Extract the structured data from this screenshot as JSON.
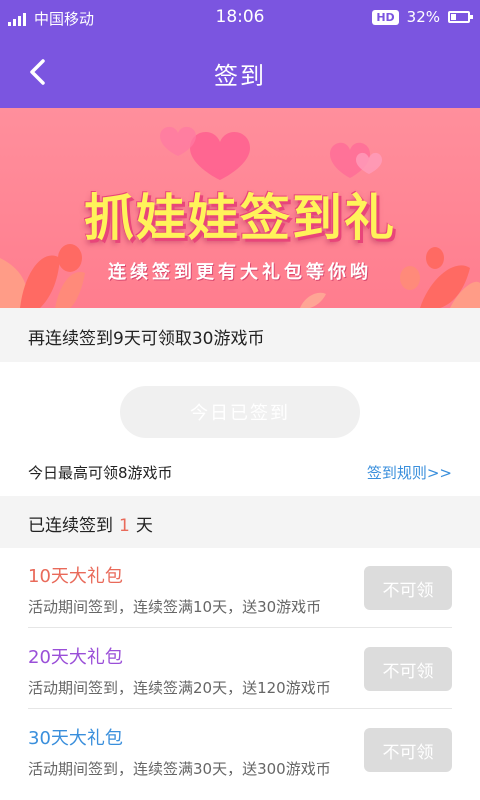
{
  "status_bar": {
    "carrier": "中国移动",
    "time": "18:06",
    "hd_badge": "HD",
    "battery": "32%"
  },
  "nav": {
    "title": "签到"
  },
  "banner": {
    "title": "抓娃娃签到礼",
    "subtitle": "连续签到更有大礼包等你哟"
  },
  "tip": "再连续签到9天可领取30游戏币",
  "sign_button": "今日已签到",
  "max_coins": "今日最高可领8游戏币",
  "rules_link": "签到规则>>",
  "streak": {
    "prefix": "已连续签到",
    "days": "1",
    "suffix": "天"
  },
  "gifts": [
    {
      "title": "10天大礼包",
      "desc": "活动期间签到，连续签满10天，送30游戏币",
      "button": "不可领",
      "color": "#e96a5a"
    },
    {
      "title": "20天大礼包",
      "desc": "活动期间签到，连续签满20天，送120游戏币",
      "button": "不可领",
      "color": "#9a4fd8"
    },
    {
      "title": "30天大礼包",
      "desc": "活动期间签到，连续签满30天，送300游戏币",
      "button": "不可领",
      "color": "#3a8fdc"
    }
  ],
  "colors": {
    "header": "#7b55e0",
    "banner": "#ff7d8e",
    "link": "#3a8fdc"
  }
}
